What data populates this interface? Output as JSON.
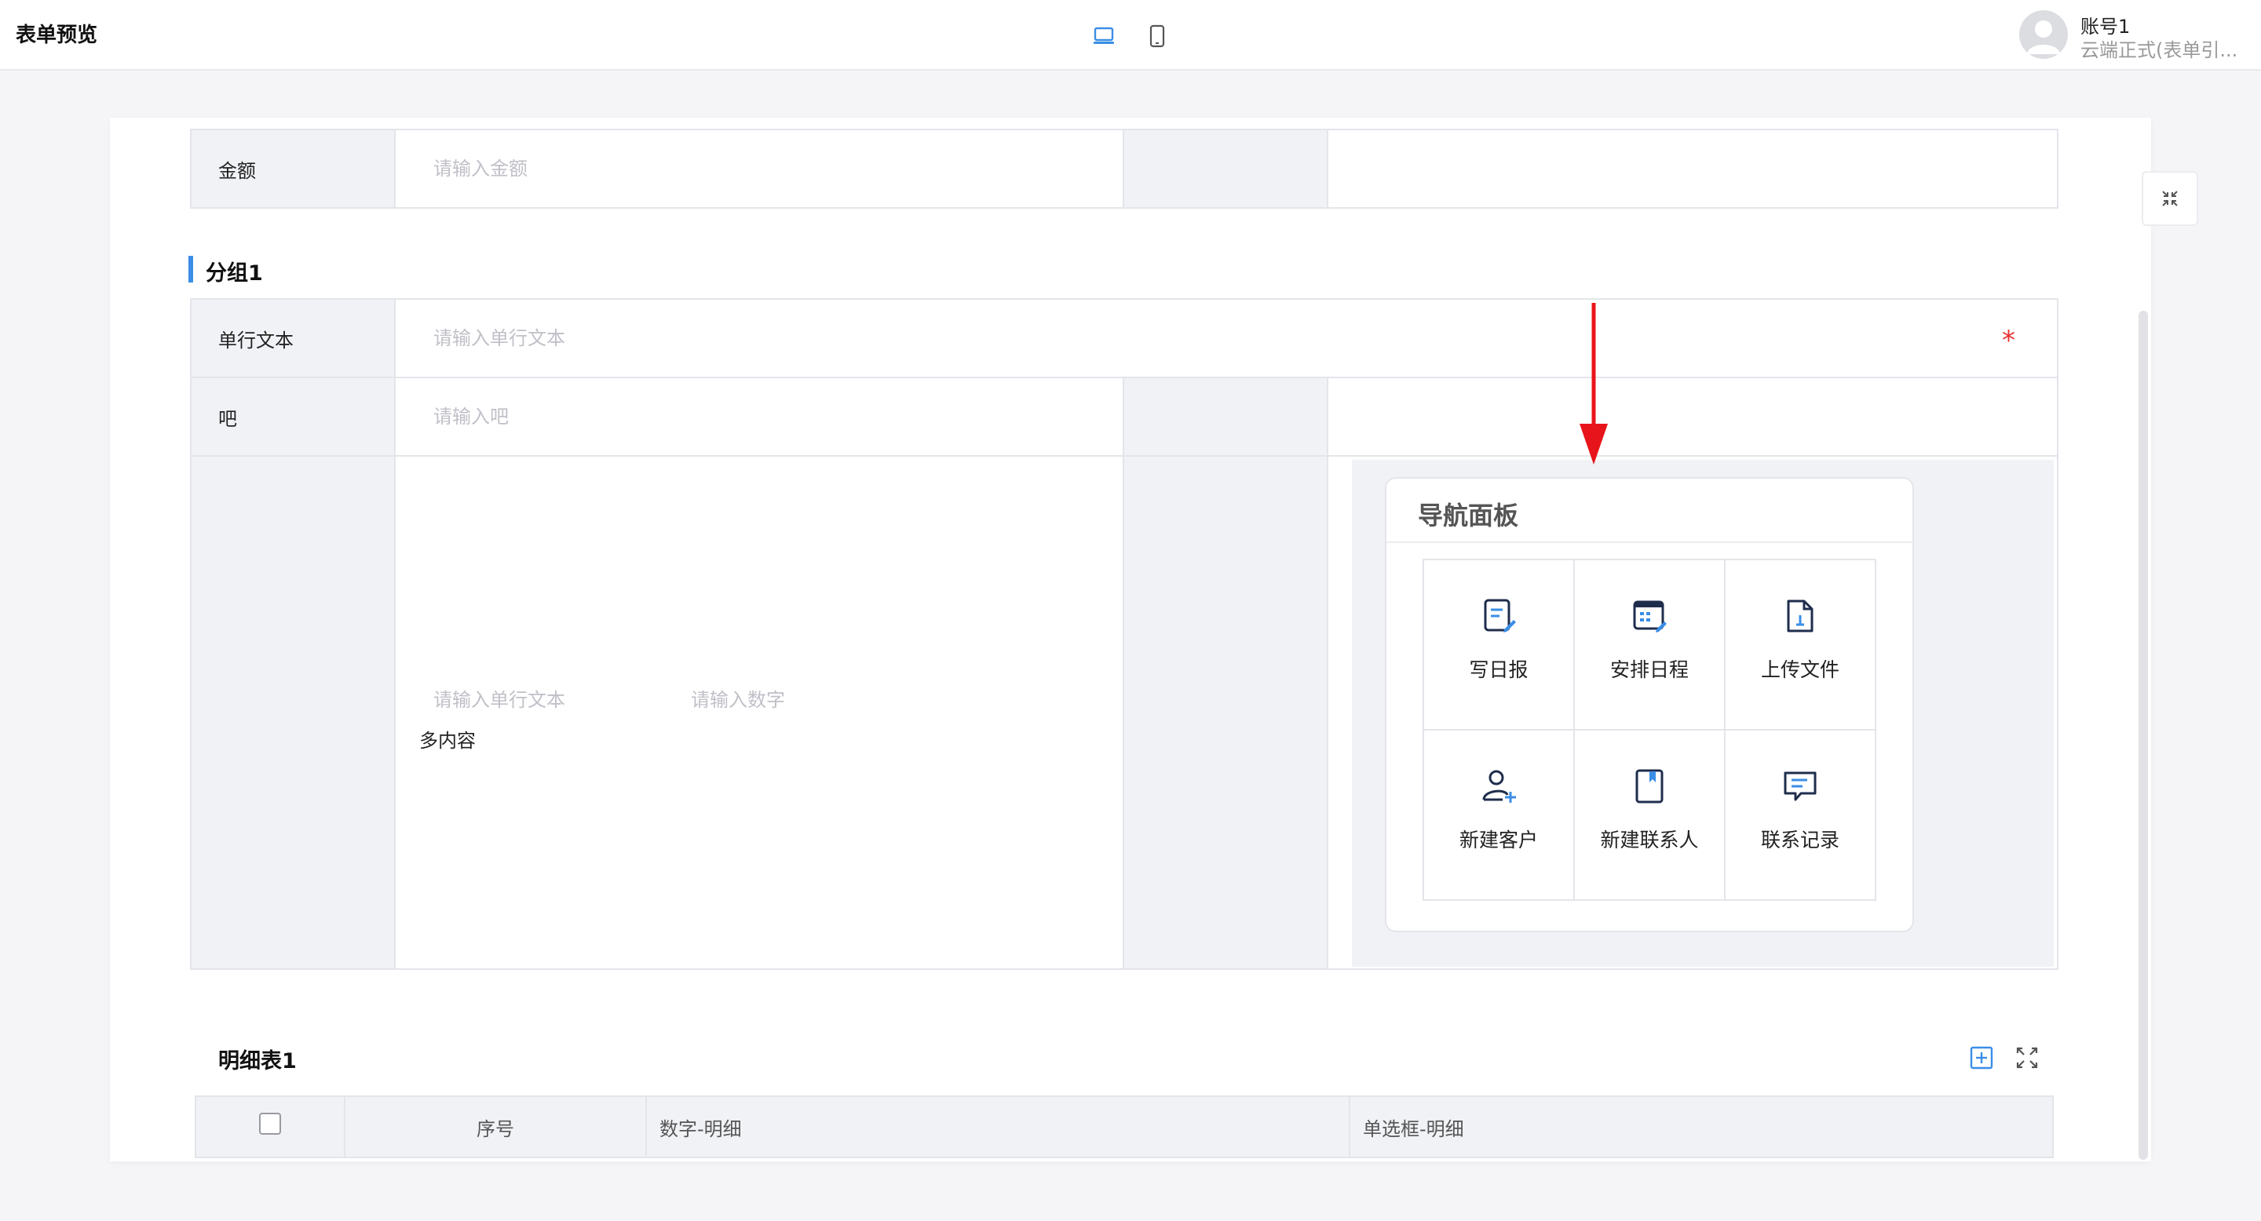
{
  "header": {
    "title": "表单预览",
    "account_name": "账号1",
    "account_sub": "云端正式(表单引..."
  },
  "form": {
    "amount": {
      "label": "金额",
      "placeholder": "请输入金额"
    },
    "group_title": "分组1",
    "single_line": {
      "label": "单行文本",
      "placeholder": "请输入单行文本",
      "required_mark": "*"
    },
    "ba": {
      "label": "吧",
      "placeholder": "请输入吧"
    },
    "multi": {
      "placeholder_text": "请输入单行文本",
      "placeholder_number": "请输入数字",
      "content_label": "多内容"
    }
  },
  "nav_panel": {
    "title": "导航面板",
    "items": [
      {
        "label": "写日报",
        "icon": "daily-report-icon"
      },
      {
        "label": "安排日程",
        "icon": "schedule-icon"
      },
      {
        "label": "上传文件",
        "icon": "upload-file-icon"
      },
      {
        "label": "新建客户",
        "icon": "new-customer-icon"
      },
      {
        "label": "新建联系人",
        "icon": "new-contact-icon"
      },
      {
        "label": "联系记录",
        "icon": "contact-record-icon"
      }
    ]
  },
  "detail": {
    "title": "明细表1",
    "columns": [
      "序号",
      "数字-明细",
      "单选框-明细"
    ]
  },
  "colors": {
    "accent": "#3a8ee6",
    "icon_dark": "#1f2d4d",
    "required": "#e63232",
    "annotation_arrow": "#e8141b"
  }
}
